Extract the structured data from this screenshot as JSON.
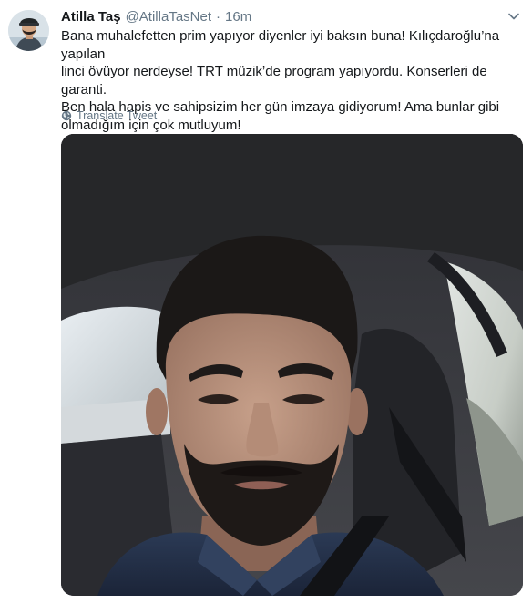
{
  "tweet": {
    "display_name": "Atilla Taş",
    "handle": "@AtillaTasNet",
    "separator": "·",
    "timestamp": "16m",
    "text": "Bana muhalefetten prim yapıyor diyenler iyi baksın buna! Kılıçdaroğlu’na yapılan\nlinci övüyor nerdeyse! TRT müzik’de program yapıyordu. Konserleri de garanti.\nBen hala hapis ve sahipsizim her gün imzaya gidiyorum! Ama bunlar gibi\nolmadığım için çok mutluyum!",
    "translate_label": "Translate Tweet"
  },
  "icons": {
    "avatar": "user-avatar",
    "more": "chevron-down-icon",
    "translate": "globe-icon",
    "media": "video-thumbnail"
  },
  "colors": {
    "text_primary": "#14171a",
    "text_secondary": "#657786",
    "background": "#ffffff"
  }
}
